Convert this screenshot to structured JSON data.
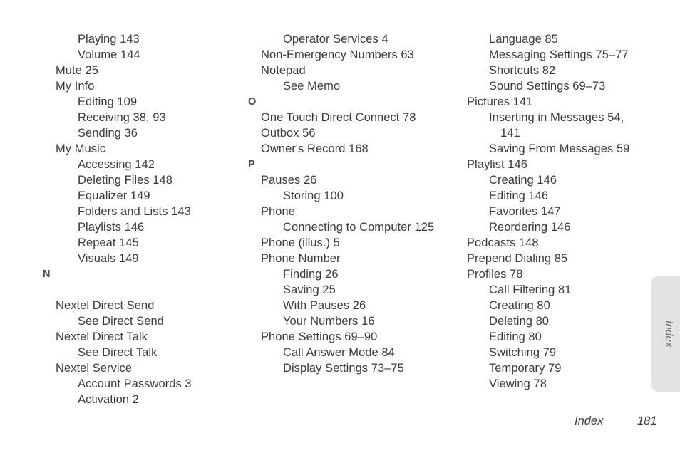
{
  "document": {
    "type": "index-page",
    "page_number": "181",
    "section_name": "Index",
    "text_color": "#3a3a3a",
    "tab_color": "#e3e3e3"
  },
  "side_tab": {
    "label": "Index"
  },
  "footer": {
    "section": "Index",
    "page": "181"
  },
  "columns": [
    {
      "id": "column-1",
      "entries": [
        {
          "kind": "entry",
          "level": 1,
          "text": "Playing 143"
        },
        {
          "kind": "entry",
          "level": 1,
          "text": "Volume 144"
        },
        {
          "kind": "entry",
          "level": 0,
          "text": "Mute 25"
        },
        {
          "kind": "entry",
          "level": 0,
          "text": "My Info"
        },
        {
          "kind": "entry",
          "level": 1,
          "text": "Editing 109"
        },
        {
          "kind": "entry",
          "level": 1,
          "text": "Receiving 38, 93"
        },
        {
          "kind": "entry",
          "level": 1,
          "text": "Sending 36"
        },
        {
          "kind": "entry",
          "level": 0,
          "text": "My Music"
        },
        {
          "kind": "entry",
          "level": 1,
          "text": "Accessing 142"
        },
        {
          "kind": "entry",
          "level": 1,
          "text": "Deleting Files 148"
        },
        {
          "kind": "entry",
          "level": 1,
          "text": "Equalizer 149"
        },
        {
          "kind": "entry",
          "level": 1,
          "text": "Folders and Lists 143"
        },
        {
          "kind": "entry",
          "level": 1,
          "text": "Playlists 146"
        },
        {
          "kind": "entry",
          "level": 1,
          "text": "Repeat 145"
        },
        {
          "kind": "entry",
          "level": 1,
          "text": "Visuals 149"
        },
        {
          "kind": "letter",
          "text": "N"
        },
        {
          "kind": "spacer",
          "text": ""
        },
        {
          "kind": "entry",
          "level": 0,
          "text": "Nextel Direct Send"
        },
        {
          "kind": "entry",
          "level": 1,
          "text": "See Direct Send"
        },
        {
          "kind": "entry",
          "level": 0,
          "text": "Nextel Direct Talk"
        },
        {
          "kind": "entry",
          "level": 1,
          "text": "See Direct Talk"
        },
        {
          "kind": "entry",
          "level": 0,
          "text": "Nextel Service"
        },
        {
          "kind": "entry",
          "level": 1,
          "text": "Account Passwords 3"
        },
        {
          "kind": "entry",
          "level": 1,
          "text": "Activation 2"
        }
      ]
    },
    {
      "id": "column-2",
      "entries": [
        {
          "kind": "entry",
          "level": 1,
          "text": "Operator Services 4"
        },
        {
          "kind": "entry",
          "level": 0,
          "text": "Non-Emergency Numbers 63"
        },
        {
          "kind": "entry",
          "level": 0,
          "text": "Notepad"
        },
        {
          "kind": "entry",
          "level": 1,
          "text": "See Memo"
        },
        {
          "kind": "letter",
          "text": "O"
        },
        {
          "kind": "entry",
          "level": 0,
          "text": "One Touch Direct Connect 78"
        },
        {
          "kind": "entry",
          "level": 0,
          "text": "Outbox 56"
        },
        {
          "kind": "entry",
          "level": 0,
          "text": "Owner's Record 168"
        },
        {
          "kind": "letter",
          "text": "P"
        },
        {
          "kind": "entry",
          "level": 0,
          "text": "Pauses 26"
        },
        {
          "kind": "entry",
          "level": 1,
          "text": "Storing 100"
        },
        {
          "kind": "entry",
          "level": 0,
          "text": "Phone"
        },
        {
          "kind": "entry",
          "level": 1,
          "text": "Connecting to Computer 125"
        },
        {
          "kind": "entry",
          "level": 0,
          "text": "Phone (illus.) 5"
        },
        {
          "kind": "entry",
          "level": 0,
          "text": "Phone Number"
        },
        {
          "kind": "entry",
          "level": 1,
          "text": "Finding 26"
        },
        {
          "kind": "entry",
          "level": 1,
          "text": "Saving 25"
        },
        {
          "kind": "entry",
          "level": 1,
          "text": "With Pauses 26"
        },
        {
          "kind": "entry",
          "level": 1,
          "text": "Your Numbers 16"
        },
        {
          "kind": "entry",
          "level": 0,
          "text": "Phone Settings 69–90"
        },
        {
          "kind": "entry",
          "level": 1,
          "text": "Call Answer Mode 84"
        },
        {
          "kind": "entry",
          "level": 1,
          "text": "Display Settings 73–75"
        }
      ]
    },
    {
      "id": "column-3",
      "entries": [
        {
          "kind": "entry",
          "level": 1,
          "text": "Language 85"
        },
        {
          "kind": "entry",
          "level": 1,
          "text": "Messaging Settings 75–77"
        },
        {
          "kind": "entry",
          "level": 1,
          "text": "Shortcuts 82"
        },
        {
          "kind": "entry",
          "level": 1,
          "text": "Sound Settings 69–73"
        },
        {
          "kind": "entry",
          "level": 0,
          "text": "Pictures 141"
        },
        {
          "kind": "entry",
          "level": 1,
          "text": "Inserting in Messages 54,"
        },
        {
          "kind": "wrap",
          "level": 1,
          "text": "141"
        },
        {
          "kind": "entry",
          "level": 1,
          "text": "Saving From Messages 59"
        },
        {
          "kind": "entry",
          "level": 0,
          "text": "Playlist 146"
        },
        {
          "kind": "entry",
          "level": 1,
          "text": "Creating 146"
        },
        {
          "kind": "entry",
          "level": 1,
          "text": "Editing 146"
        },
        {
          "kind": "entry",
          "level": 1,
          "text": "Favorites 147"
        },
        {
          "kind": "entry",
          "level": 1,
          "text": "Reordering 146"
        },
        {
          "kind": "entry",
          "level": 0,
          "text": "Podcasts 148"
        },
        {
          "kind": "entry",
          "level": 0,
          "text": "Prepend Dialing 85"
        },
        {
          "kind": "entry",
          "level": 0,
          "text": "Profiles 78"
        },
        {
          "kind": "entry",
          "level": 1,
          "text": "Call Filtering 81"
        },
        {
          "kind": "entry",
          "level": 1,
          "text": "Creating 80"
        },
        {
          "kind": "entry",
          "level": 1,
          "text": "Deleting 80"
        },
        {
          "kind": "entry",
          "level": 1,
          "text": "Editing 80"
        },
        {
          "kind": "entry",
          "level": 1,
          "text": "Switching 79"
        },
        {
          "kind": "entry",
          "level": 1,
          "text": "Temporary 79"
        },
        {
          "kind": "entry",
          "level": 1,
          "text": "Viewing 78"
        }
      ]
    }
  ]
}
